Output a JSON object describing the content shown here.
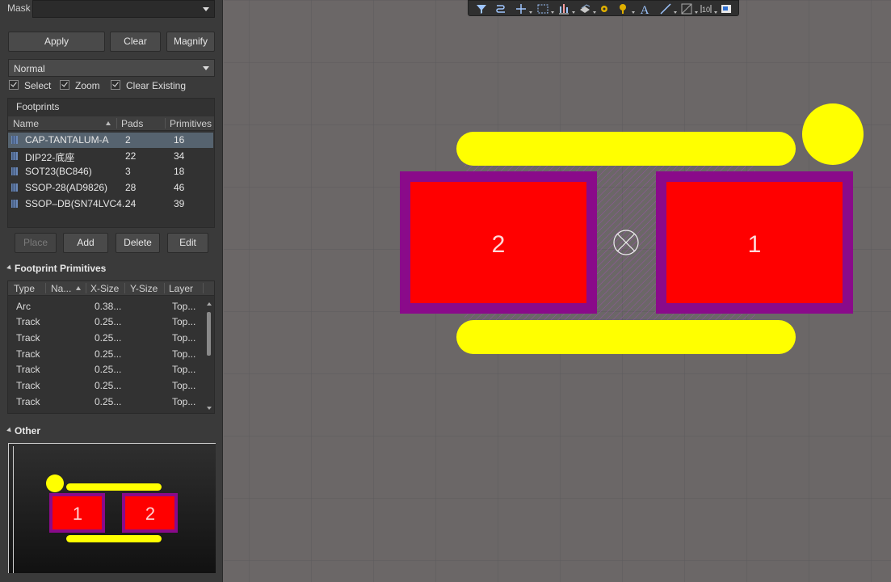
{
  "mask": {
    "label": "Mask",
    "value": ""
  },
  "buttons": {
    "apply": "Apply",
    "clear": "Clear",
    "magnify": "Magnify"
  },
  "mode": {
    "value": "Normal"
  },
  "checks": [
    {
      "label": "Select",
      "checked": true
    },
    {
      "label": "Zoom",
      "checked": true
    },
    {
      "label": "Clear Existing",
      "checked": true
    }
  ],
  "footprints": {
    "title": "Footprints",
    "columns": [
      "Name",
      "Pads",
      "Primitives"
    ],
    "rows": [
      {
        "name": "CAP-TANTALUM-A",
        "pads": "2",
        "primitives": "16",
        "selected": true
      },
      {
        "name": "DIP22-底座",
        "pads": "22",
        "primitives": "34"
      },
      {
        "name": "SOT23(BC846)",
        "pads": "3",
        "primitives": "18"
      },
      {
        "name": "SSOP-28(AD9826)",
        "pads": "28",
        "primitives": "46"
      },
      {
        "name": "SSOP–DB(SN74LVC4...",
        "pads": "24",
        "primitives": "39"
      }
    ]
  },
  "fp_buttons": {
    "place": "Place",
    "add": "Add",
    "delete": "Delete",
    "edit": "Edit"
  },
  "primitives": {
    "title": "Footprint Primitives",
    "columns": [
      "Type",
      "Na...",
      "X-Size",
      "Y-Size",
      "Layer"
    ],
    "rows": [
      {
        "type": "Arc",
        "xsize": "0.38...",
        "layer": "Top..."
      },
      {
        "type": "Track",
        "xsize": "0.25...",
        "layer": "Top..."
      },
      {
        "type": "Track",
        "xsize": "0.25...",
        "layer": "Top..."
      },
      {
        "type": "Track",
        "xsize": "0.25...",
        "layer": "Top..."
      },
      {
        "type": "Track",
        "xsize": "0.25...",
        "layer": "Top..."
      },
      {
        "type": "Track",
        "xsize": "0.25...",
        "layer": "Top..."
      },
      {
        "type": "Track",
        "xsize": "0.25...",
        "layer": "Top..."
      }
    ]
  },
  "other": {
    "title": "Other",
    "preview_pad_labels": [
      "1",
      "2"
    ]
  },
  "canvas": {
    "pad_labels": [
      "2",
      "1"
    ]
  },
  "toolbar_icons": [
    "filter-icon",
    "route-icon",
    "cross-icon",
    "select-rect-icon",
    "align-icon",
    "layer-icon",
    "via-icon",
    "pad-icon",
    "text-icon",
    "line-icon",
    "fill-icon",
    "dimension-icon",
    "view-icon"
  ],
  "colors": {
    "pad_fill": "#ff0000",
    "solder_mask": "#8a0a8a",
    "silkscreen": "#ffff00",
    "canvas_bg": "#6b6767",
    "panel_bg": "#3a3a3a",
    "selection": "#56636f"
  }
}
